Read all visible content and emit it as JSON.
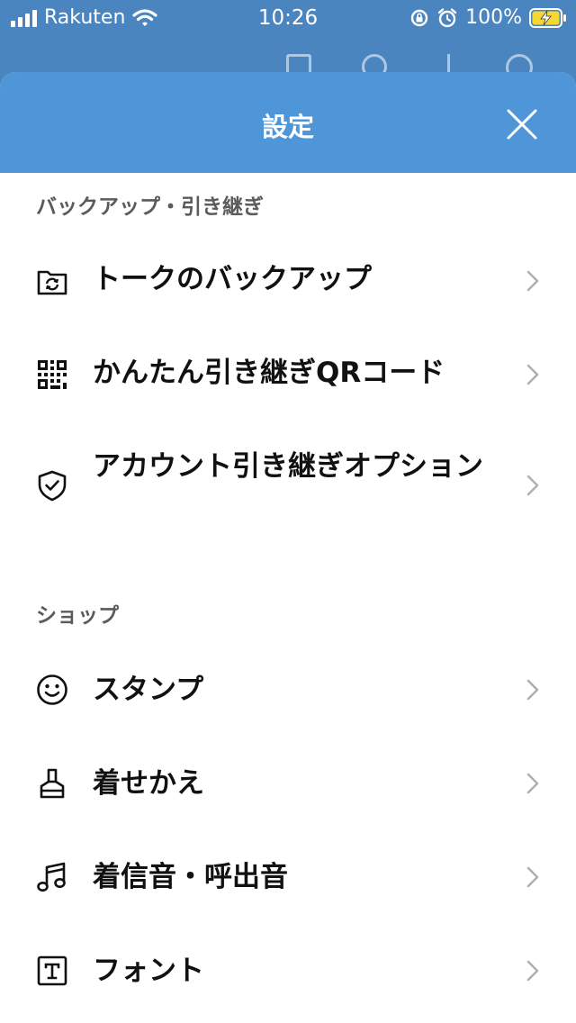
{
  "status_bar": {
    "carrier": "Rakuten",
    "time": "10:26",
    "battery": "100%"
  },
  "header": {
    "title": "設定",
    "close_icon": "close-icon"
  },
  "sections": [
    {
      "title": "バックアップ・引き継ぎ",
      "items": [
        {
          "label": "トークのバックアップ",
          "icon": "folder-sync-icon"
        },
        {
          "label": "かんたん引き継ぎQRコード",
          "icon": "qr-code-icon"
        },
        {
          "label": "アカウント引き継ぎオプション",
          "icon": "shield-check-icon"
        }
      ]
    },
    {
      "title": "ショップ",
      "items": [
        {
          "label": "スタンプ",
          "icon": "smiley-icon"
        },
        {
          "label": "着せかえ",
          "icon": "brush-icon"
        },
        {
          "label": "着信音・呼出音",
          "icon": "music-note-icon"
        },
        {
          "label": "フォント",
          "icon": "font-icon"
        }
      ]
    }
  ],
  "colors": {
    "header_bg": "#4f96d8",
    "status_bg": "#4a85c0",
    "section_text": "#5b5b5b",
    "item_text": "#111111",
    "chevron": "#b0b0b0"
  }
}
